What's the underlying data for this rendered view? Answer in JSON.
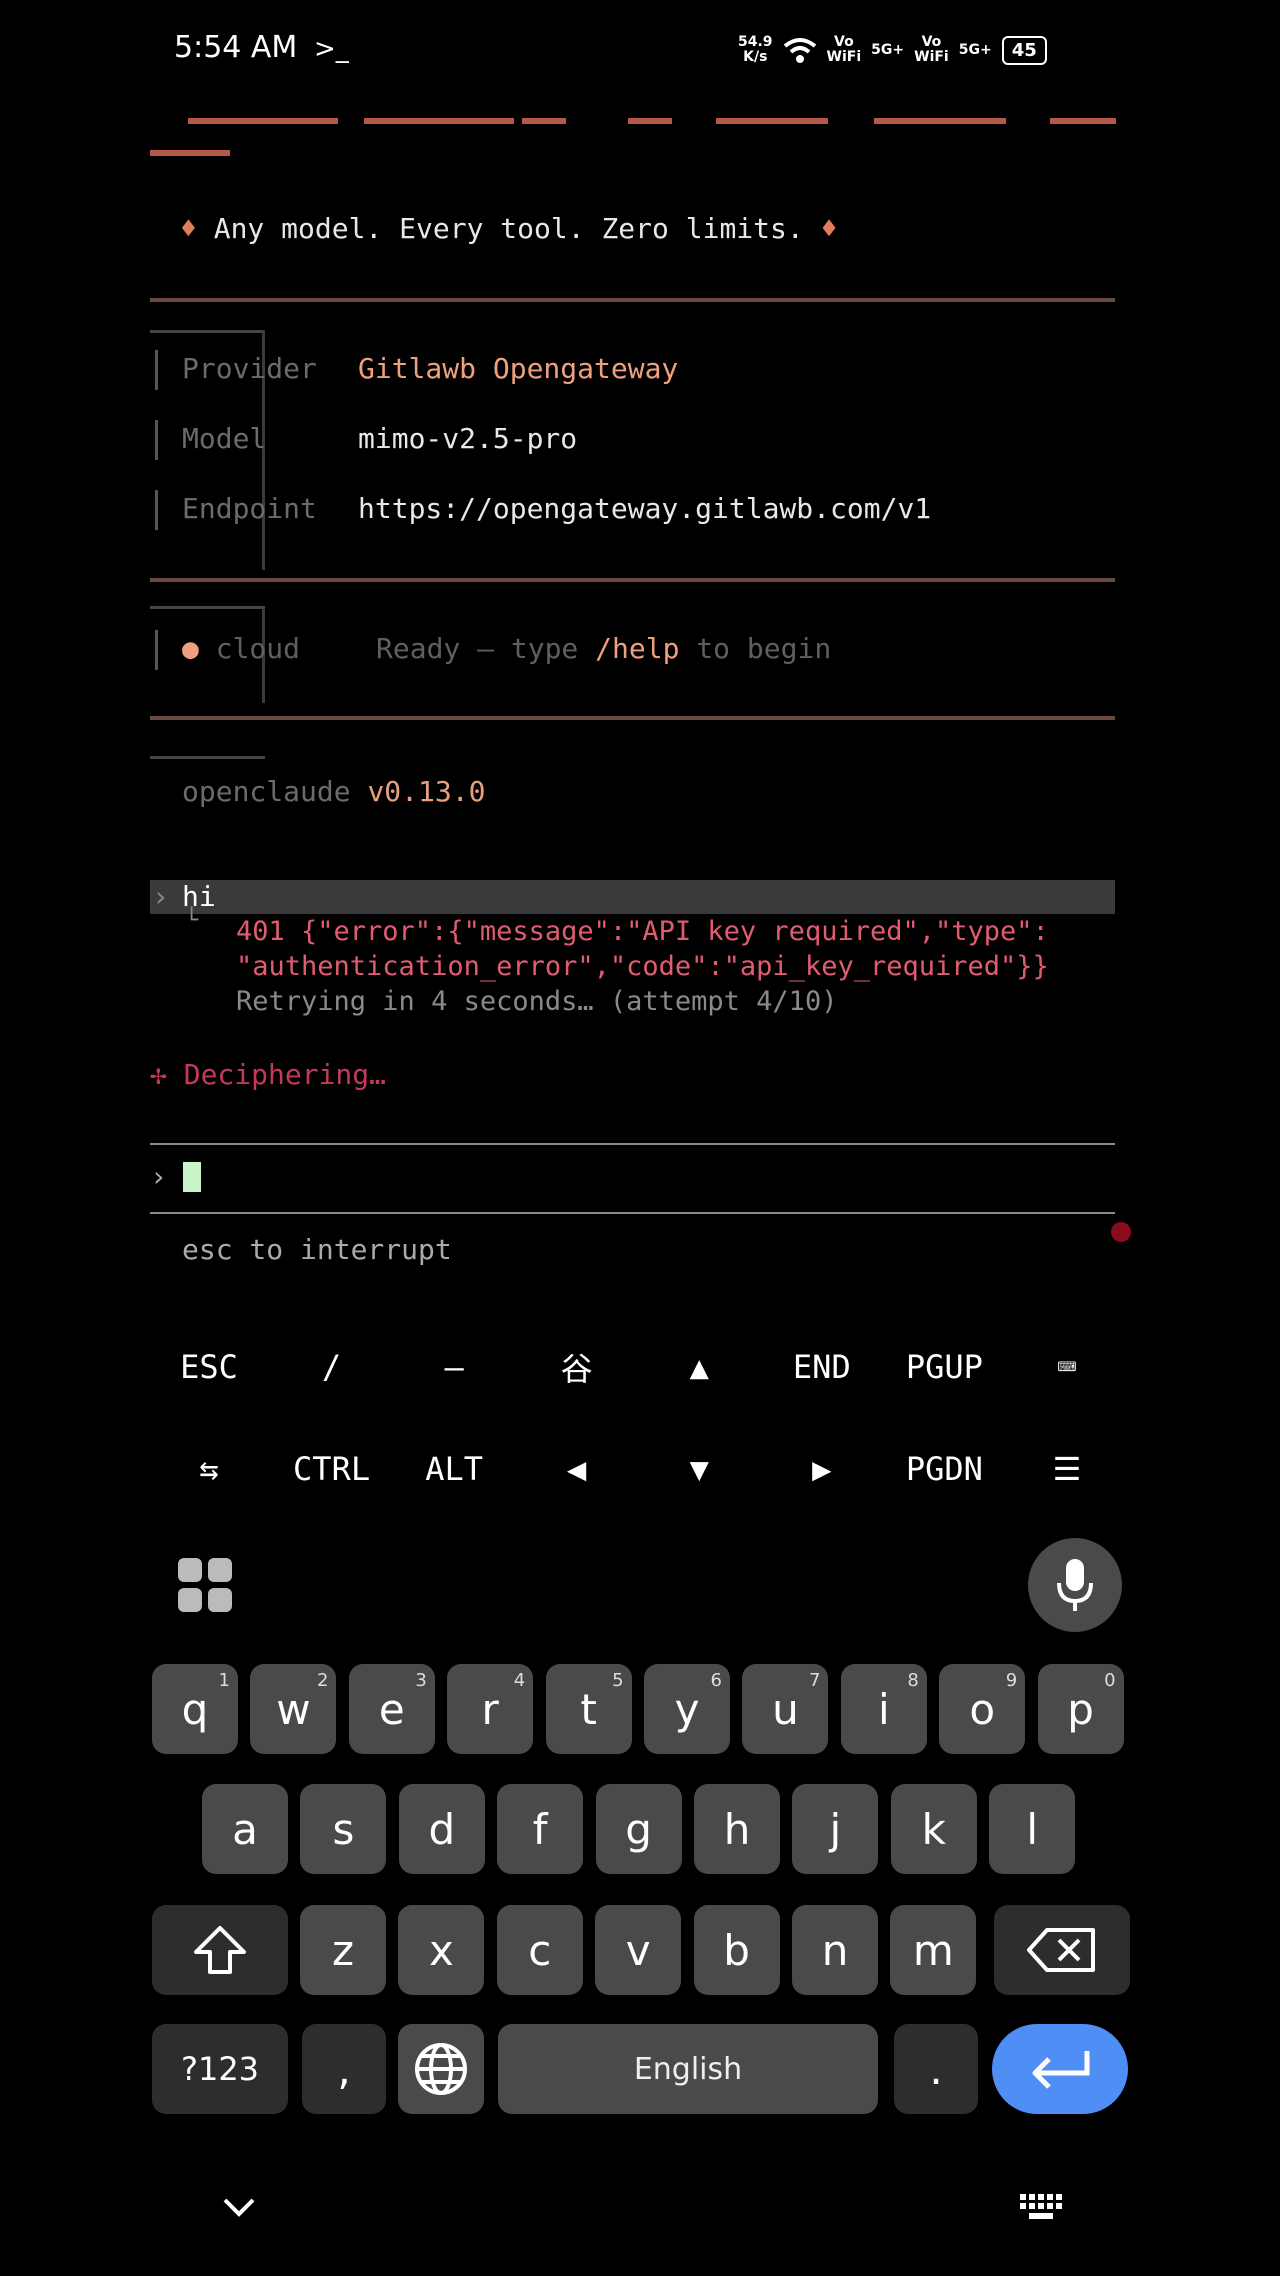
{
  "status_bar": {
    "time": "5:54 AM",
    "prompt_glyph": ">_",
    "speed": "54.9\nK/s",
    "net1": "Vo\nWiFi",
    "net2": "5G+",
    "net3": "Vo\nWiFi",
    "net4": "5G+",
    "battery": "45"
  },
  "terminal": {
    "tagline": "Any model. Every tool. Zero limits.",
    "tagline_diamond": "♦",
    "provider_label": "Provider",
    "provider_value": "Gitlawb Opengateway",
    "model_label": "Model",
    "model_value": "mimo-v2.5-pro",
    "endpoint_label": "Endpoint",
    "endpoint_value": "https://opengateway.gitlawb.com/v1",
    "cloud_bullet": "●",
    "cloud_label": "cloud",
    "ready_pre": "Ready — type",
    "ready_cmd": "/help",
    "ready_post": "to begin",
    "app_name": "openclaude",
    "version": "v0.13.0",
    "user_input": "hi",
    "error_line1": "401 {\"error\":{\"message\":\"API key required\",\"type\":",
    "error_line2": "\"authentication_error\",\"code\":\"api_key_required\"}}",
    "retry_line": "Retrying in 4 seconds… (attempt 4/10)",
    "status_glyph": "✢",
    "status_text": "Deciphering…",
    "prompt_chevron": "›",
    "hint": "esc to interrupt"
  },
  "extra_keys": {
    "row1": [
      "ESC",
      "/",
      "—",
      "谷",
      "▲",
      "END",
      "PGUP",
      "⌨"
    ],
    "row2": [
      "⇆",
      "CTRL",
      "ALT",
      "◀",
      "▼",
      "▶",
      "PGDN",
      "☰"
    ]
  },
  "keyboard": {
    "row1": [
      {
        "k": "q",
        "s": "1"
      },
      {
        "k": "w",
        "s": "2"
      },
      {
        "k": "e",
        "s": "3"
      },
      {
        "k": "r",
        "s": "4"
      },
      {
        "k": "t",
        "s": "5"
      },
      {
        "k": "y",
        "s": "6"
      },
      {
        "k": "u",
        "s": "7"
      },
      {
        "k": "i",
        "s": "8"
      },
      {
        "k": "o",
        "s": "9"
      },
      {
        "k": "p",
        "s": "0"
      }
    ],
    "row2": [
      "a",
      "s",
      "d",
      "f",
      "g",
      "h",
      "j",
      "k",
      "l"
    ],
    "row3": [
      "z",
      "x",
      "c",
      "v",
      "b",
      "n",
      "m"
    ],
    "symbols_label": "?123",
    "comma": ",",
    "space_label": "English",
    "period": "."
  },
  "icons": {
    "apps": "grid-icon",
    "mic": "microphone-icon",
    "shift": "shift-icon",
    "backspace": "backspace-icon",
    "globe": "globe-icon",
    "enter": "enter-icon",
    "nav_down": "chevron-down-icon",
    "nav_keyboard": "keyboard-icon"
  },
  "colors": {
    "accent_peach": "#f0a07f",
    "error_red": "#e25c70",
    "enter_blue": "#4f8ef5"
  }
}
